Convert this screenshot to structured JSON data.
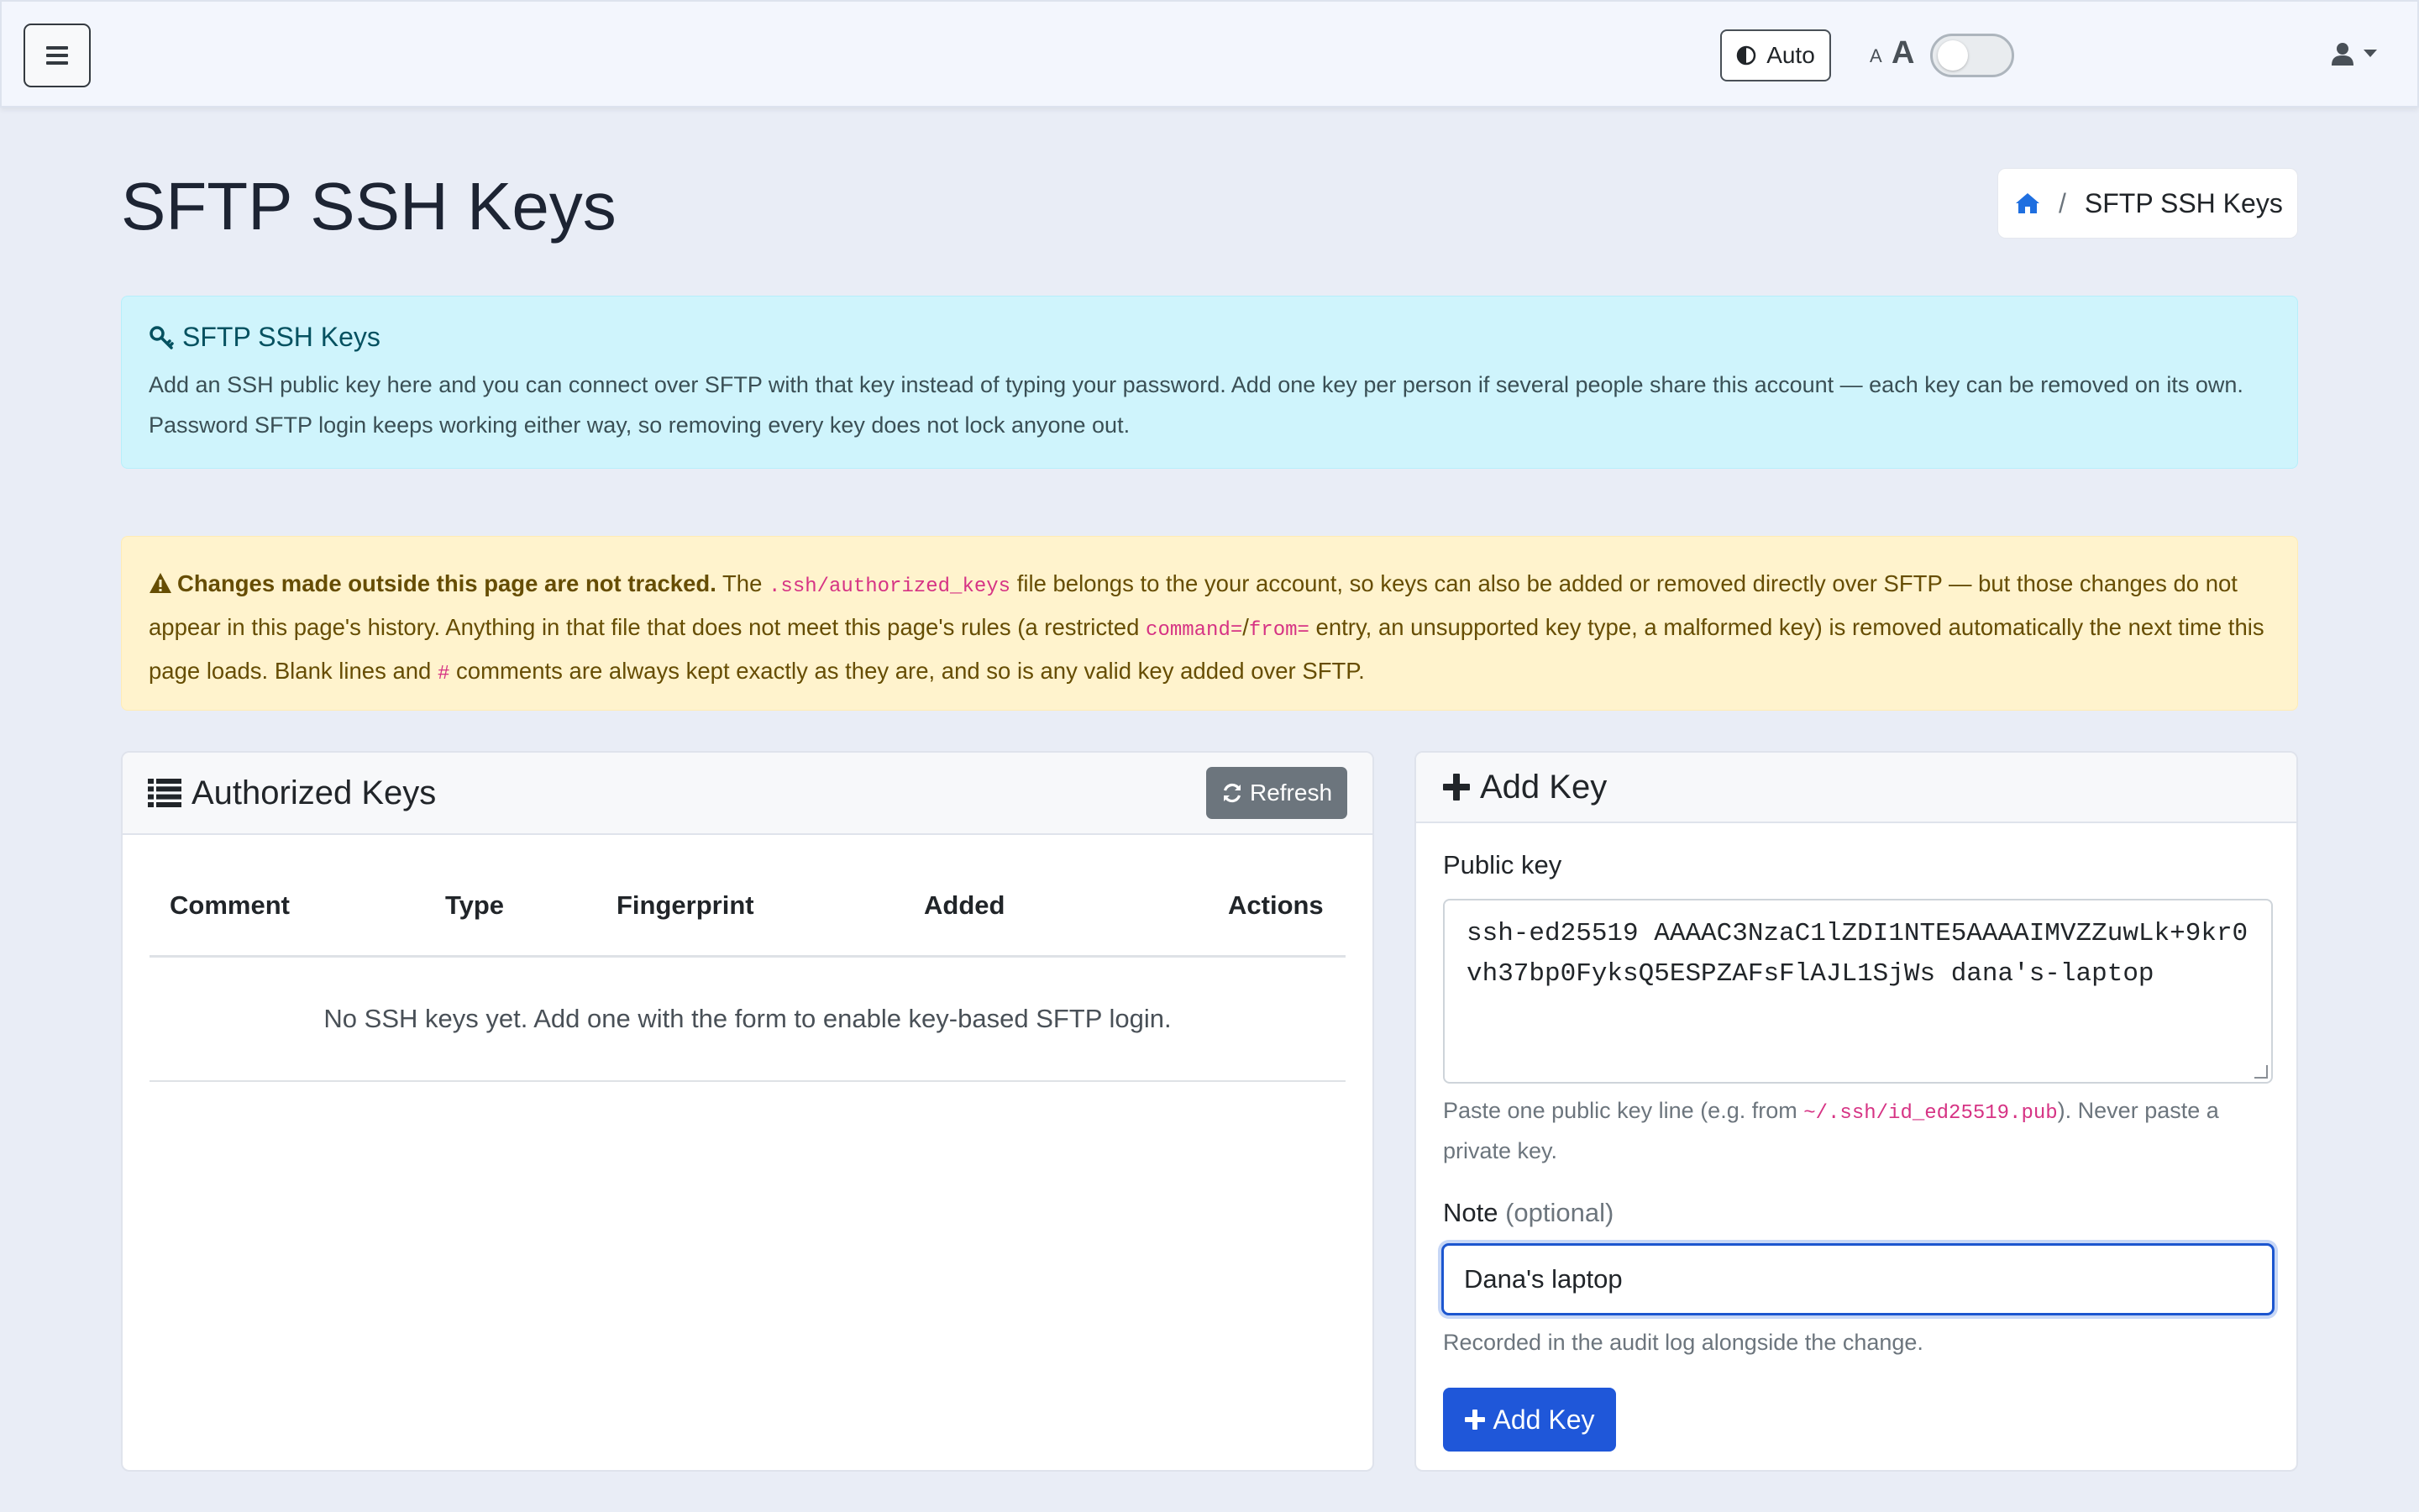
{
  "navbar": {
    "theme_label": "Auto",
    "font_small": "A",
    "font_large": "A",
    "icons": [
      "menu-icon",
      "contrast-icon",
      "user-icon",
      "caret-down-icon"
    ]
  },
  "header": {
    "title": "SFTP SSH Keys",
    "breadcrumb": {
      "current": "SFTP SSH Keys",
      "separator": "/"
    }
  },
  "info_alert": {
    "title": "SFTP SSH Keys",
    "body": "Add an SSH public key here and you can connect over SFTP with that key instead of typing your password. Add one key per person if several people share this account — each key can be removed on its own. Password SFTP login keeps working either way, so removing every key does not lock anyone out."
  },
  "warning_alert": {
    "strong": "Changes made outside this page are not tracked.",
    "t1": " The ",
    "code1": ".ssh/authorized_keys",
    "t2": " file belongs to the your account, so keys can also be added or removed directly over SFTP — but those changes do not appear in this page's history. Anything in that file that does not meet this page's rules (a restricted ",
    "code2": "command=",
    "t3": "/",
    "code3": "from=",
    "t4": " entry, an unsupported key type, a malformed key) is removed automatically the next time this page loads. Blank lines and ",
    "code4": "#",
    "t5": " comments are always kept exactly as they are, and so is any valid key added over SFTP."
  },
  "keys_card": {
    "title": "Authorized Keys",
    "refresh_label": "Refresh",
    "columns": [
      "Comment",
      "Type",
      "Fingerprint",
      "Added",
      "Actions"
    ],
    "empty_message": "No SSH keys yet. Add one with the form to enable key-based SFTP login."
  },
  "add_card": {
    "title": "Add Key",
    "public_key_label": "Public key",
    "public_key_value": "ssh-ed25519 AAAAC3NzaC1lZDI1NTE5AAAAIMVZZuwLk+9kr0vh37bp0FyksQ5ESPZAFsFlAJL1SjWs dana's-laptop",
    "public_key_help_1": "Paste one public key line (e.g. from ",
    "public_key_help_code": "~/.ssh/id_ed25519.pub",
    "public_key_help_2": "). Never paste a private key.",
    "note_label": "Note",
    "note_optional": "(optional)",
    "note_value": "Dana's laptop",
    "note_help": "Recorded in the audit log alongside the change.",
    "submit_label": "Add Key"
  },
  "colors": {
    "primary": "#1f57d9",
    "info_bg": "#cff4fc",
    "warning_bg": "#fff3cd",
    "secondary": "#6c757d",
    "code": "#d63384"
  }
}
